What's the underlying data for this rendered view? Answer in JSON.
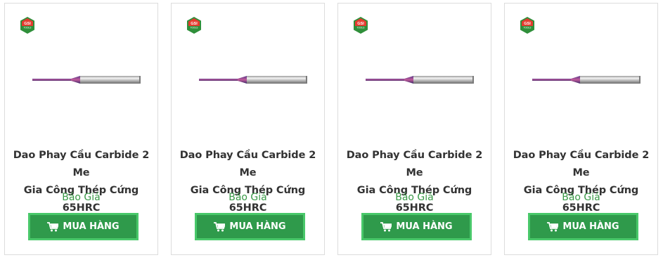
{
  "products": [
    {
      "title_line1": "Dao Phay Cầu Carbide 2 Me",
      "title_line2": "Gia Công Thép Cứng 65HRC",
      "price": "Báo Giá",
      "button": "MUA HÀNG",
      "logo_text": "GSI TOOLS"
    },
    {
      "title_line1": "Dao Phay Cầu Carbide 2 Me",
      "title_line2": "Gia Công Thép Cứng 65HRC",
      "price": "Báo Giá",
      "button": "MUA HÀNG",
      "logo_text": "GSI TOOLS"
    },
    {
      "title_line1": "Dao Phay Cầu Carbide 2 Me",
      "title_line2": "Gia Công Thép Cứng 65HRC",
      "price": "Báo Giá",
      "button": "MUA HÀNG",
      "logo_text": "GSI TOOLS"
    },
    {
      "title_line1": "Dao Phay Cầu Carbide 2 Me",
      "title_line2": "Gia Công Thép Cứng 65HRC",
      "price": "Báo Giá",
      "button": "MUA HÀNG",
      "logo_text": "GSI TOOLS"
    }
  ],
  "colors": {
    "accent": "#2f9a4b",
    "button_border": "#49c86a",
    "price": "#3a9a48"
  },
  "icons": {
    "cart": "shopping-cart-icon",
    "logo": "gsi-tools-logo"
  }
}
